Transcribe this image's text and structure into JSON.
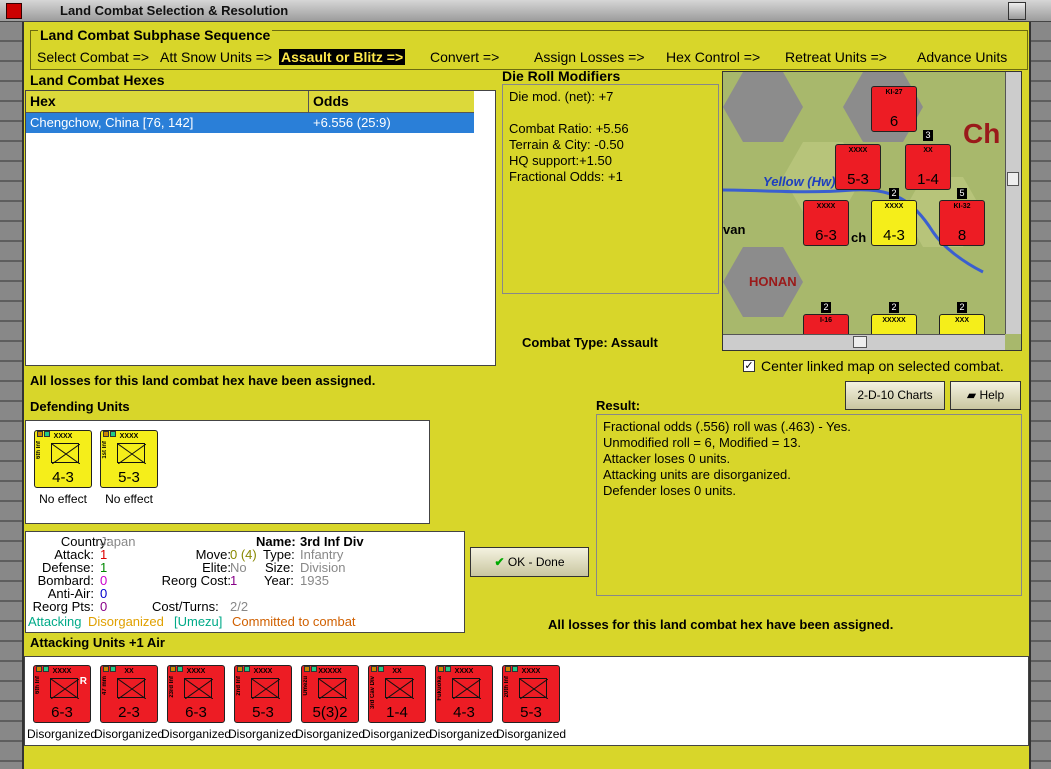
{
  "window": {
    "title": "Land Combat Selection & Resolution"
  },
  "subphase": {
    "label": "Land Combat Subphase Sequence",
    "steps": [
      "Select Combat =>",
      "Att Snow Units =>",
      "Assault or Blitz =>",
      "Convert =>",
      "Assign Losses =>",
      "Hex Control =>",
      "Retreat Units =>",
      "Advance Units"
    ],
    "active_index": 2
  },
  "hexes": {
    "label": "Land Combat Hexes",
    "columns": [
      "Hex",
      "Odds"
    ],
    "rows": [
      {
        "hex": "Chengchow, China [76, 142]",
        "odds": "+6.556 (25:9)"
      }
    ]
  },
  "die_roll": {
    "label": "Die Roll Modifiers",
    "lines": [
      "Die mod. (net): +7",
      "",
      "Combat Ratio: +5.56",
      "Terrain & City: -0.50",
      "HQ support:+1.50",
      "Fractional Odds: +1"
    ]
  },
  "combat_type": {
    "label": "Combat Type:",
    "value": "Assault"
  },
  "map": {
    "river_label": "Yellow (Hw",
    "river_label_tail": ")",
    "province_label": "HONAN",
    "place_fragment": "van",
    "place_fragment2": "ch",
    "corner_label": "Ch",
    "center_checkbox_label": "Center linked map on selected combat.",
    "center_checked": true,
    "counters": [
      {
        "code": "KI-27",
        "str": "6",
        "color": "#ed1c24"
      },
      {
        "code": "XXXX",
        "str": "5-3",
        "color": "#ed1c24"
      },
      {
        "code": "XX",
        "str": "1-4",
        "color": "#ed1c24"
      },
      {
        "code": "XXXX",
        "str": "6-3",
        "color": "#ed1c24"
      },
      {
        "code": "XXXX",
        "str": "4-3",
        "color": "#f5ee1a"
      },
      {
        "code": "KI-32",
        "str": "8",
        "color": "#ed1c24"
      },
      {
        "code": "I-16",
        "str": "",
        "color": "#ed1c24"
      },
      {
        "code": "XXXXX",
        "str": "",
        "color": "#f5ee1a"
      },
      {
        "code": "XXX",
        "str": "",
        "color": "#f5ee1a"
      }
    ],
    "stack_counts": [
      "3",
      "2",
      "5",
      "2",
      "2",
      "2"
    ]
  },
  "buttons": {
    "charts": "2-D-10 Charts",
    "help": "Help",
    "ok": "OK - Done"
  },
  "losses_msg": "All losses for this land combat hex have been assigned.",
  "defending": {
    "label": "Defending Units",
    "units": [
      {
        "code": "XXXX",
        "side": "6th Inf",
        "str": "4-3",
        "status": "No effect"
      },
      {
        "code": "XXXX",
        "side": "1st Inf",
        "str": "5-3",
        "status": "No effect"
      }
    ]
  },
  "result": {
    "label": "Result:",
    "lines": [
      "Fractional odds (.556) roll was (.463)  - Yes.",
      "Unmodified roll = 6, Modified = 13.",
      "Attacker loses 0 units.",
      "Attacking units are disorganized.",
      "Defender loses 0 units."
    ]
  },
  "unit_info": {
    "country_k": "Country:",
    "country_v": "Japan",
    "attack_k": "Attack:",
    "attack_v": "1",
    "defense_k": "Defense:",
    "defense_v": "1",
    "bombard_k": "Bombard:",
    "bombard_v": "0",
    "antiair_k": "Anti-Air:",
    "antiair_v": "0",
    "reorg_pts_k": "Reorg Pts:",
    "reorg_pts_v": "0",
    "name_k": "Name:",
    "name_v": "3rd Inf Div",
    "move_k": "Move:",
    "move_v": "0 (4)",
    "type_k": "Type:",
    "type_v": "Infantry",
    "elite_k": "Elite:",
    "elite_v": "No",
    "size_k": "Size:",
    "size_v": "Division",
    "reorg_cost_k": "Reorg Cost:",
    "reorg_cost_v": "1",
    "year_k": "Year:",
    "year_v": "1935",
    "cost_k": "Cost/Turns:",
    "cost_v": "2/2",
    "status_attacking": "Attacking",
    "status_disorg": "Disorganized",
    "status_hq": "[Umezu]",
    "status_committed": "Committed to combat"
  },
  "attacking": {
    "label": "Attacking Units +1 Air",
    "units": [
      {
        "code": "XXXX",
        "side": "6th Inf",
        "str": "6-3",
        "tag": "R",
        "status": "Disorganized"
      },
      {
        "code": "XX",
        "side": "47 mm",
        "str": "2-3",
        "tag": "",
        "status": "Disorganized"
      },
      {
        "code": "XXXX",
        "side": "23rd Inf",
        "str": "6-3",
        "tag": "",
        "status": "Disorganized"
      },
      {
        "code": "XXXX",
        "side": "2nd Inf",
        "str": "5-3",
        "tag": "",
        "status": "Disorganized"
      },
      {
        "code": "XXXXX",
        "side": "Umezu",
        "str": "5(3)2",
        "tag": "",
        "status": "Disorganized"
      },
      {
        "code": "XX",
        "side": "3rd Cav Div",
        "str": "1-4",
        "tag": "",
        "status": "Disorganized"
      },
      {
        "code": "XXXX",
        "side": "Fukuoka",
        "str": "4-3",
        "tag": "",
        "status": "Disorganized"
      },
      {
        "code": "XXXX",
        "side": "20th Inf",
        "str": "5-3",
        "tag": "",
        "status": "Disorganized"
      }
    ]
  },
  "colors": {
    "panel": "#d8d62a",
    "counter_red": "#ed1c24",
    "counter_yellow": "#f5ee1a",
    "selection": "#2a7fd8"
  }
}
